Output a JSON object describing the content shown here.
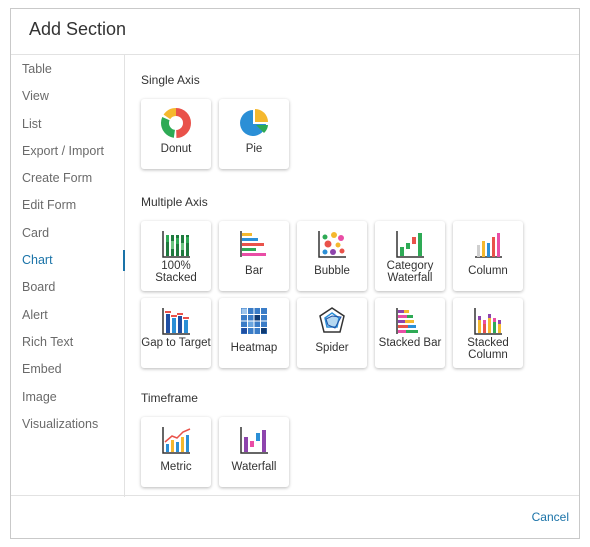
{
  "dialog": {
    "title": "Add Section"
  },
  "sidebar": {
    "items": [
      {
        "label": "Table"
      },
      {
        "label": "View"
      },
      {
        "label": "List"
      },
      {
        "label": "Export / Import"
      },
      {
        "label": "Create Form"
      },
      {
        "label": "Edit Form"
      },
      {
        "label": "Card"
      },
      {
        "label": "Chart",
        "active": true
      },
      {
        "label": "Board"
      },
      {
        "label": "Alert"
      },
      {
        "label": "Rich Text"
      },
      {
        "label": "Embed"
      },
      {
        "label": "Image"
      },
      {
        "label": "Visualizations"
      }
    ],
    "accent": "#1a73a8"
  },
  "sections": {
    "single_axis": {
      "title": "Single Axis",
      "tiles": [
        {
          "label": "Donut",
          "icon": "donut-chart-icon"
        },
        {
          "label": "Pie",
          "icon": "pie-chart-icon"
        }
      ]
    },
    "multiple_axis": {
      "title": "Multiple Axis",
      "tiles": [
        {
          "label": "100% Stacked",
          "icon": "stacked-100-icon"
        },
        {
          "label": "Bar",
          "icon": "bar-chart-icon"
        },
        {
          "label": "Bubble",
          "icon": "bubble-chart-icon"
        },
        {
          "label": "Category Waterfall",
          "icon": "category-waterfall-icon"
        },
        {
          "label": "Column",
          "icon": "column-chart-icon"
        },
        {
          "label": "Gap to Target",
          "icon": "gap-to-target-icon"
        },
        {
          "label": "Heatmap",
          "icon": "heatmap-icon"
        },
        {
          "label": "Spider",
          "icon": "spider-chart-icon"
        },
        {
          "label": "Stacked Bar",
          "icon": "stacked-bar-icon"
        },
        {
          "label": "Stacked Column",
          "icon": "stacked-column-icon"
        }
      ]
    },
    "timeframe": {
      "title": "Timeframe",
      "tiles": [
        {
          "label": "Metric",
          "icon": "metric-chart-icon"
        },
        {
          "label": "Waterfall",
          "icon": "waterfall-chart-icon"
        }
      ]
    }
  },
  "footer": {
    "cancel_label": "Cancel"
  }
}
